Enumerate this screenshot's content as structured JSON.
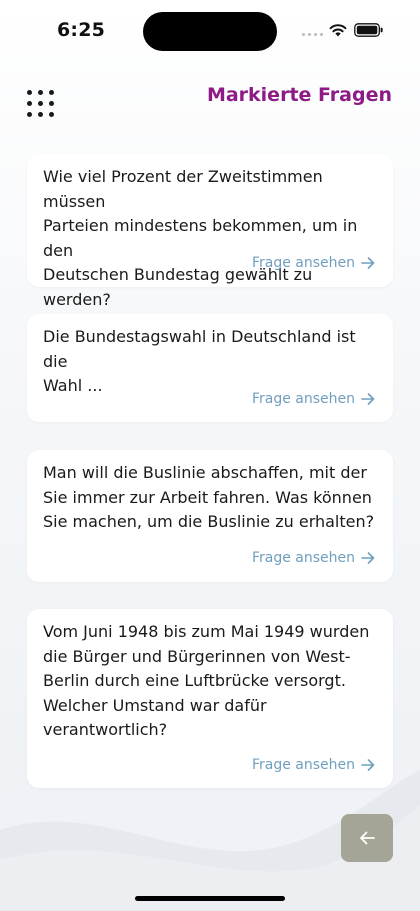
{
  "status_bar": {
    "time": "6:25",
    "icons": [
      "cellular-icon",
      "wifi-icon",
      "battery-icon"
    ]
  },
  "header": {
    "menu_icon": "grid-menu-icon",
    "title": "Markierte Fragen",
    "title_color": "#8e1a86"
  },
  "questions": [
    {
      "text": "Wie viel Prozent der Zweitstimmen müssen\nParteien mindestens bekommen, um in den\nDeutschen Bundestag gewählt zu werden?",
      "link_label": "Frage ansehen"
    },
    {
      "text": "Die Bundestagswahl in Deutschland ist die\nWahl ...",
      "link_label": "Frage ansehen"
    },
    {
      "text": "Man will die Buslinie abschaffen, mit der\nSie immer zur Arbeit fahren. Was können\nSie machen, um die Buslinie zu erhalten?",
      "link_label": "Frage ansehen"
    },
    {
      "text": "Vom Juni 1948 bis zum Mai 1949 wurden\ndie Bürger und Bürgerinnen von West-\nBerlin durch eine Luftbrücke versorgt.\nWelcher Umstand war dafür\nverantwortlich?",
      "link_label": "Frage ansehen"
    }
  ],
  "colors": {
    "link": "#6f9fbf",
    "back_button": "#a4a497",
    "card_background": "#ffffff"
  },
  "back_button": {
    "icon": "arrow-left-icon"
  }
}
